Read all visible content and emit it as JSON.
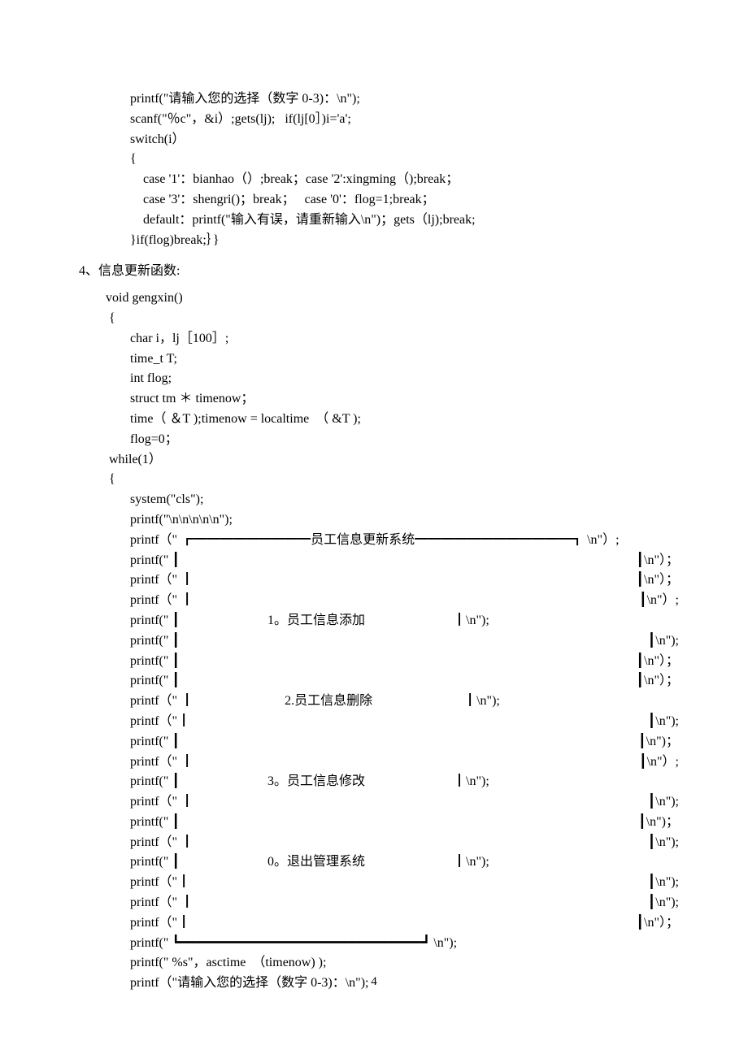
{
  "code1": {
    "l1": "printf(\"请输入您的选择（数字 0-3)：\\n\");",
    "l2": "scanf(\"％c\"，&i）;gets(lj);   if(lj[0］)i='a';",
    "l3": "switch(i）",
    "l4": "{",
    "l5": "    case '1'：bianhao（）;break；case '2':xingming（);break；",
    "l6": "    case '3'：shengri()；break；   case '0'：flog=1;break；",
    "l7": "    default：printf(\"输入有误，请重新输入\\n\")；gets（lj);break;",
    "l8": "}if(flog)break;｝}"
  },
  "heading": "4、信息更新函数:",
  "code2": {
    "l1": "void gengxin()",
    "l2": " {",
    "l3": "char i，lj［100］;",
    "l4": "time_t T;",
    "l5": "int flog;",
    "l6": "struct tm ＊ timenow；",
    "l7": "time（ ＆T );timenow = localtime  （ &T );",
    "l8": "flog=0；"
  },
  "code3": {
    "l1": " while(1）",
    "l2": " {",
    "l3": "system(\"cls\");",
    "l4": "printf(\"\\n\\n\\n\\n\\n\");"
  },
  "box": {
    "top_prefix": "printf（\" ┏",
    "top_dash": "━━━━━━━━━员工信息更新系统━━━━━━━━━━━━┓ \\n\"）;",
    "blank_prefix": "printf(\" ┃",
    "blank_prefix2": "printf（\" ┃",
    "blank_prefix3": "printf（\"┃",
    "right_end1": "┃\\n\"）;",
    "right_end2": "┃\\n\")；",
    "right_end3": "┃\\n\");",
    "right_end4": "┃\\n\"）；",
    "item1_prefix": "printf(\" ┃",
    "item1_text": "                           1。员工信息添加                           ┃\\n\");",
    "item2_prefix": "printf（\" ┃",
    "item2_text": "                            2.员工信息删除                            ┃\\n\");",
    "item3_prefix": "printf(\" ┃",
    "item3_text": "                           3。员工信息修改                           ┃\\n\");",
    "item0_prefix": "printf(\" ┃",
    "item0_text": "                           0。退出管理系统                           ┃\\n\");",
    "bottom_prefix": "printf(\" ┗",
    "bottom_dash": "━━━━━━━━━━━━━━━━━━━━━━━━━━━━━━━┛ \\n\");"
  },
  "code4": {
    "l1": "printf(\" %s\"，asctime  （timenow) );",
    "l2": "printf（\"请输入您的选择（数字 0-3)：\\n\");"
  },
  "page_number": "4"
}
